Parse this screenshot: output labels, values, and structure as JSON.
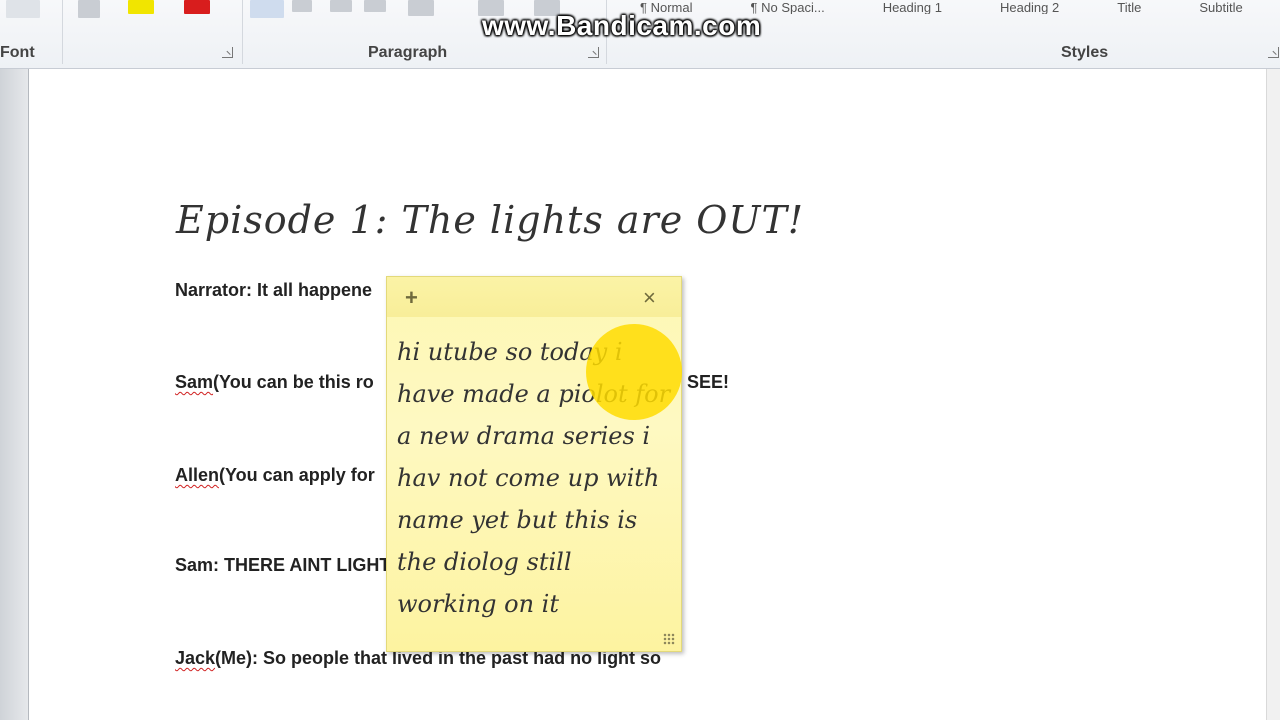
{
  "watermark": "www.Bandicam.com",
  "ribbon": {
    "groups": {
      "font": "Font",
      "paragraph": "Paragraph",
      "styles": "Styles"
    },
    "styles_gallery": [
      "¶ Normal",
      "¶ No Spaci...",
      "Heading 1",
      "Heading 2",
      "Title",
      "Subtitle"
    ]
  },
  "document": {
    "title": "Episode 1: The lights are OUT!",
    "lines": [
      {
        "name": "Narrator",
        "text": "Narrator: It all happene"
      },
      {
        "name": "Sam",
        "prefix": "Sam",
        "text": "(You can be this ro",
        "tail": "SEE!"
      },
      {
        "name": "Allen",
        "prefix": "Allen",
        "text": "(You can apply for"
      },
      {
        "name": "Sam2",
        "text": "Sam: THERE AINT LIGHT"
      },
      {
        "name": "Jack",
        "prefix": "Jack",
        "text": "(Me): So people that lived in the past had no light so"
      }
    ]
  },
  "sticky_note": {
    "add_label": "+",
    "close_label": "×",
    "text": "hi utube so today i have made a piolot for a new drama series i hav not come up with name yet but this is the diolog still working on it"
  },
  "colors": {
    "note_background": "#fef9c2",
    "cursor_highlight": "#ffdc00",
    "spell_check": "#d02020"
  }
}
